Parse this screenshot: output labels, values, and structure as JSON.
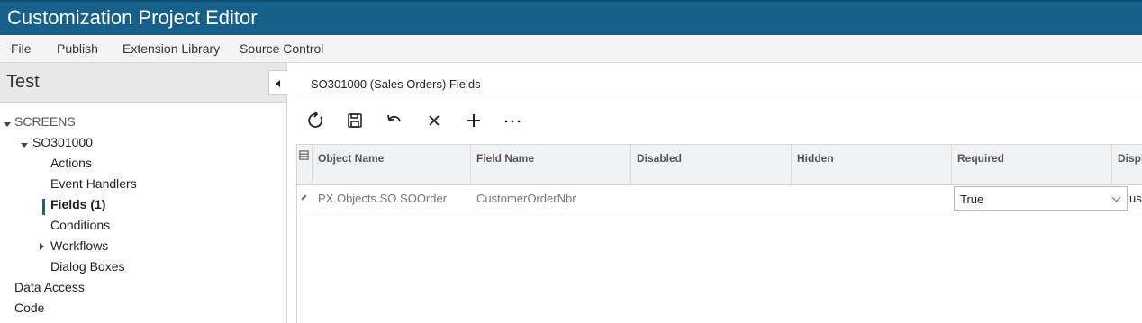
{
  "app": {
    "title": "Customization Project Editor"
  },
  "menu": {
    "items": [
      "File",
      "Publish",
      "Extension Library",
      "Source Control"
    ]
  },
  "sidebar": {
    "project_name": "Test",
    "tree": {
      "screens": "SCREENS",
      "screen_id": "SO301000",
      "actions": "Actions",
      "event_handlers": "Event Handlers",
      "fields": "Fields (1)",
      "conditions": "Conditions",
      "workflows": "Workflows",
      "dialog_boxes": "Dialog Boxes",
      "data_access": "Data Access",
      "code": "Code"
    }
  },
  "main": {
    "title": "SO301000 (Sales Orders) Fields",
    "toolbar": [
      "refresh-icon",
      "save-icon",
      "undo-icon",
      "delete-icon",
      "add-icon",
      "more-icon"
    ],
    "grid": {
      "columns": [
        "Object Name",
        "Field Name",
        "Disabled",
        "Hidden",
        "Required",
        "Displ"
      ],
      "rows": [
        {
          "object_name": "PX.Objects.SO.SOOrder",
          "field_name": "CustomerOrderNbr",
          "disabled": "",
          "hidden": "",
          "required": "True",
          "display": "ust"
        }
      ]
    }
  },
  "colors": {
    "titlebar": "#176089",
    "accent": "#176089",
    "header_bg": "#f1f2f4"
  }
}
